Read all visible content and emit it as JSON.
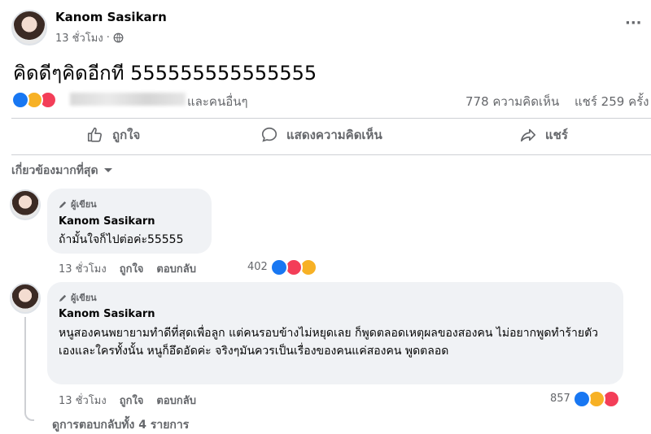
{
  "post": {
    "author": "Kanom Sasikarn",
    "time": "13 ชั่วโมง",
    "separator": "·",
    "more_label": "···",
    "text": "คิดดีๆคิดอีกที 555555555555555"
  },
  "reactions": {
    "others": "และคนอื่นๆ",
    "comments": "778 ความคิดเห็น",
    "shares": "แชร์ 259 ครั้ง"
  },
  "actions": {
    "like": "ถูกใจ",
    "comment": "แสดงความคิดเห็น",
    "share": "แชร์"
  },
  "sort": {
    "label": "เกี่ยวข้องมากที่สุด"
  },
  "comments": [
    {
      "badge": "ผู้เขียน",
      "name": "Kanom Sasikarn",
      "text": "ถ้ามั้นใจก็ไปต่อค่ะ55555",
      "time": "13 ชั่วโมง",
      "like": "ถูกใจ",
      "reply": "ตอบกลับ",
      "reaction_count": "402"
    },
    {
      "badge": "ผู้เขียน",
      "name": "Kanom Sasikarn",
      "text": "หนูสองคนพยายามทำดีที่สุดเพื่อลูก แต่คนรอบข้างไม่หยุดเลย ก็พูดตลอดเหตุผลของสองคน ไม่อยากพูดทำร้ายตัวเองและใครทั้งนั้น หนูก็อึดอัดค่ะ จริงๆมันควรเป็นเรื่องของคนแค่สองคน พูดตลอด",
      "time": "13 ชั่วโมง",
      "like": "ถูกใจ",
      "reply": "ตอบกลับ",
      "reaction_count": "857"
    }
  ],
  "view_replies": "ดูการตอบกลับทั้ง 4 รายการ",
  "colors": {
    "like": "#1877f2",
    "care": "#f7b125",
    "love": "#f33e58",
    "muted": "#65676b"
  }
}
